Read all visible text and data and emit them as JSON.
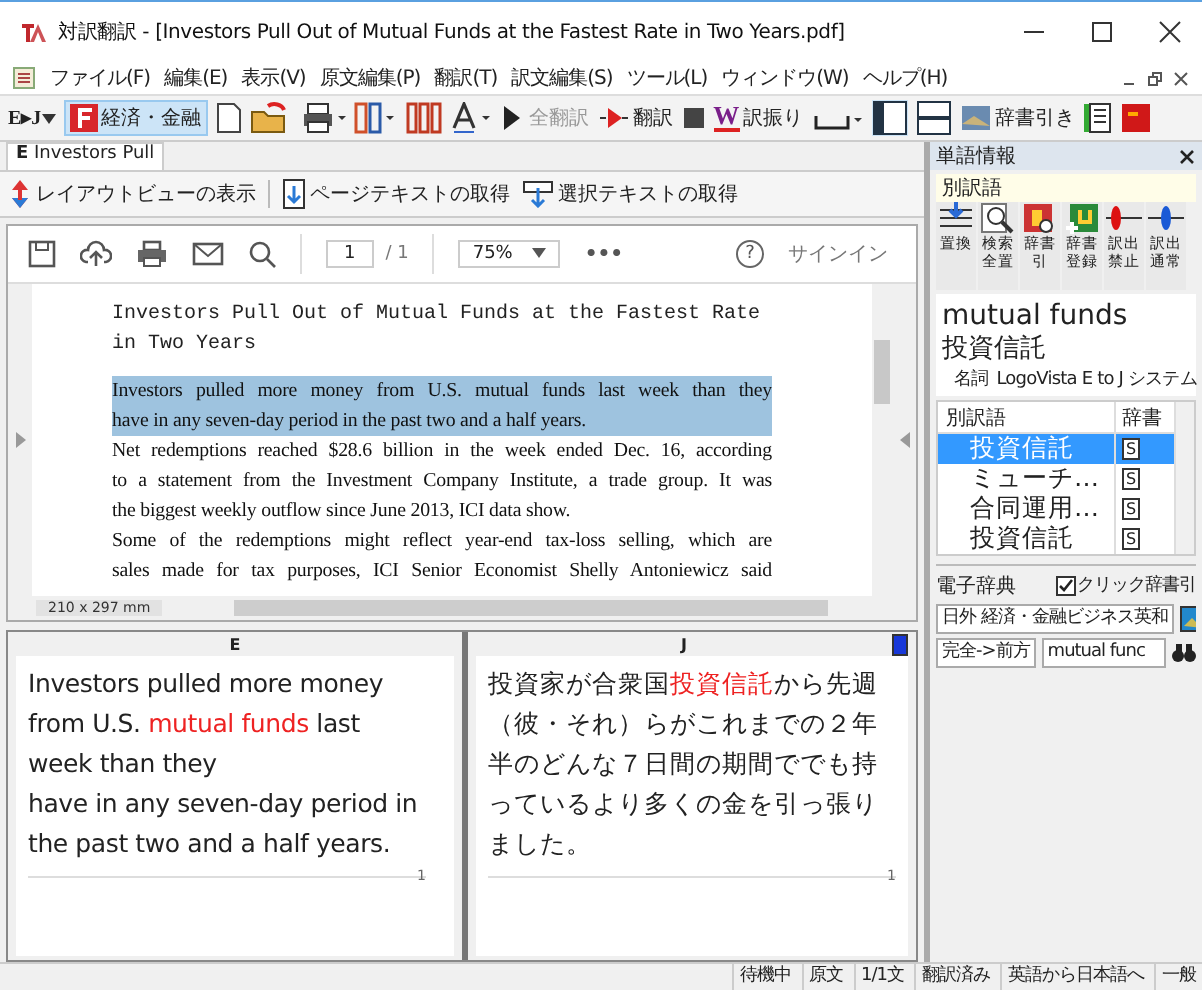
{
  "window": {
    "title": "対訳翻訳 - [Investors Pull Out of Mutual Funds at the Fastest Rate in Two Years.pdf]"
  },
  "menu": [
    "ファイル(F)",
    "編集(E)",
    "表示(V)",
    "原文編集(P)",
    "翻訳(T)",
    "訳文編集(S)",
    "ツール(L)",
    "ウィンドウ(W)",
    "ヘルプ(H)"
  ],
  "toolbar": {
    "language_pair": "E▸J",
    "field": {
      "label": "経済・金融",
      "selected": true
    },
    "translate_all": {
      "label": "全翻訳",
      "disabled": true
    },
    "translate": "翻訳",
    "furigana": "訳振り",
    "furigana_logo": "W",
    "dictionary": "辞書引き"
  },
  "document_tab": {
    "label": "Investors Pull",
    "badge": "E"
  },
  "document_toolbar": [
    "レイアウトビューの表示",
    "ページテキストの取得",
    "選択テキストの取得"
  ],
  "pdf_viewer": {
    "page": "1",
    "page_total": "/ 1",
    "zoom": "75%",
    "more": "•••",
    "help": "?",
    "sign_in": "サインイン",
    "page_size": "210 x 297 mm",
    "title": "Investors Pull Out of Mutual Funds at the Fastest Rate in Two Years",
    "paragraphs": [
      {
        "lines": [
          "Investors pulled more money from U.S. mutual funds last week than they",
          "have in any seven-day period in the past two and a half years."
        ],
        "selected": true
      },
      {
        "lines": [
          "Net redemptions reached $28.6 billion in the week ended Dec. 16, according",
          "to a statement from the Investment Company Institute, a trade group. It was",
          "the biggest weekly outflow since June 2013, ICI data show."
        ],
        "selected": false
      },
      {
        "lines": [
          "Some of the redemptions might reflect year-end tax-loss selling, which are",
          "sales made for tax purposes, ICI Senior Economist Shelly Antoniewicz said"
        ],
        "selected": false
      }
    ]
  },
  "bilingual": {
    "source_header": "E",
    "target_header": "J",
    "source_sentence_number": "1",
    "target_sentence_number": "1",
    "source": [
      [
        {
          "text": "Investors pulled more money from U.S. ",
          "highlight": false
        },
        {
          "text": "mutual funds",
          "highlight": true
        },
        {
          "text": " last week than they",
          "highlight": false
        }
      ],
      [
        {
          "text": "have in any seven-day period in the past two and a half years.",
          "highlight": false
        }
      ]
    ],
    "target": [
      [
        {
          "text": "投資家が合衆国",
          "highlight": false
        },
        {
          "text": "投資信託",
          "highlight": true
        },
        {
          "text": "から先週（彼・それ）らがこれまでの２年半のどんな７日間の期間ででも持っているより多くの金を引っ張りました。",
          "highlight": false
        }
      ]
    ]
  },
  "word_panel": {
    "title": "単語情報",
    "section": "別訳語",
    "tools": [
      "置換",
      "検索全置",
      "辞書引",
      "辞書登録",
      "訳出禁止",
      "訳出通常"
    ],
    "word": "mutual funds",
    "translation": "投資信託",
    "part_of_speech": "名詞",
    "dictionary_name": "LogoVista E to J システム",
    "columns": [
      "別訳語",
      "辞書"
    ],
    "rows": [
      {
        "term": "投資信託",
        "dict": "S",
        "selected": true
      },
      {
        "term": "ミューチ…",
        "dict": "S",
        "selected": false
      },
      {
        "term": "合同運用…",
        "dict": "S",
        "selected": false
      },
      {
        "term": "投資信託",
        "dict": "S",
        "selected": false
      }
    ]
  },
  "e_dictionary": {
    "title": "電子辞典",
    "click_lookup": {
      "label": "クリック辞書引",
      "checked": true
    },
    "dictionary": "日外 経済・金融ビジネス英和",
    "match": "完全->前方",
    "query": "mutual func"
  },
  "status_bar": [
    "待機中",
    "原文",
    "1/1文",
    "翻訳済み",
    "英語から日本語へ",
    "一般"
  ]
}
